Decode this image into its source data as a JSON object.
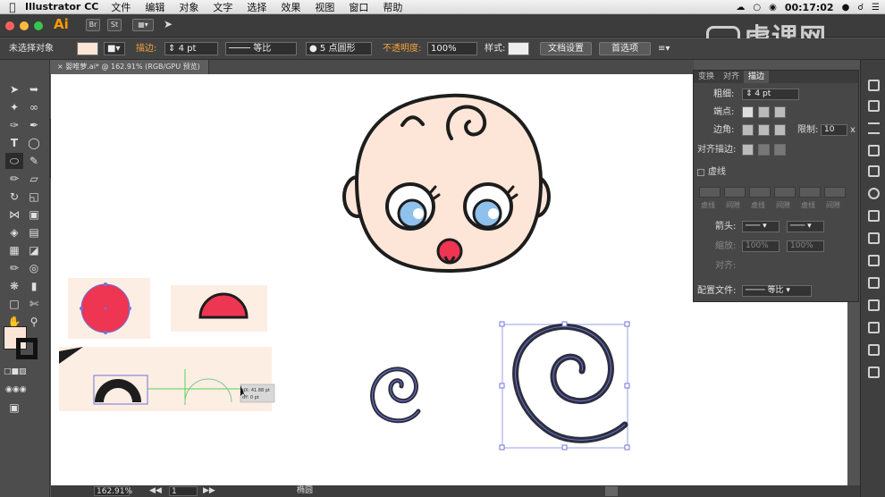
{
  "menubar": {
    "app_name": "Illustrator CC",
    "items": [
      "文件",
      "编辑",
      "对象",
      "文字",
      "选择",
      "效果",
      "视图",
      "窗口",
      "帮助"
    ],
    "clock": "00:17:02"
  },
  "appbar": {
    "logo": "Ai",
    "watermark": "虎课网"
  },
  "controlbar": {
    "selection": "未选择对象",
    "stroke_label": "描边:",
    "stroke_value": "4 pt",
    "profile": "等比",
    "brush": "5 点圆形",
    "opacity_label": "不透明度:",
    "opacity_value": "100%",
    "style_label": "样式:",
    "doc_setup": "文档设置",
    "preferences": "首选项"
  },
  "document": {
    "tab_title": "婴唯萝.ai* @ 162.91% (RGB/GPU 预览)"
  },
  "panel": {
    "tabs": [
      "变换",
      "对齐",
      "描边"
    ],
    "weight_label": "粗细:",
    "weight_value": "4 pt",
    "cap_label": "端点:",
    "corner_label": "边角:",
    "limit_label": "限制:",
    "limit_value": "10",
    "limit_unit": "x",
    "align_label": "对齐描边:",
    "dashed_label": "虚线",
    "dash_labels": [
      "虚线",
      "间隙",
      "虚线",
      "间隙",
      "虚线",
      "间隙"
    ],
    "arrow_label": "箭头:",
    "scale_label": "缩放:",
    "scale_1": "100%",
    "scale_2": "100%",
    "align_arrow_label": "对齐:",
    "profile_label": "配置文件:",
    "profile_value": "等比"
  },
  "canvas": {
    "measure_dx": "dX: 41.88 pt",
    "measure_dy": "dY: 0 pt"
  },
  "status": {
    "zoom": "162.91%",
    "artboard": "1",
    "tool": "椭圆"
  },
  "colors": {
    "skin": "#fde6d8",
    "outline": "#1d1d1d",
    "eye_blue": "#8ec1ec",
    "pacifier": "#ee3552",
    "spiral": "#2d2f3d",
    "selection": "#6f74d9",
    "artboard_bg": "#fdeee3"
  }
}
